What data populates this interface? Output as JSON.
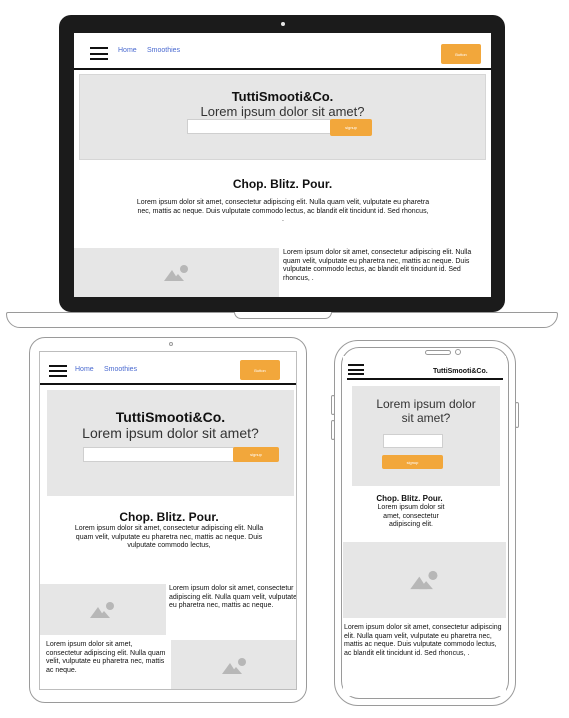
{
  "laptop": {
    "nav": {
      "home": "Home",
      "smoothies": "Smoothies",
      "button": "Button"
    },
    "hero": {
      "brand": "TuttiSmooti&Co.",
      "tagline": "Lorem ipsum dolor sit amet?",
      "input_placeholder": "",
      "signup": "signup"
    },
    "section": {
      "heading": "Chop. Blitz. Pour.",
      "paragraph": "Lorem ipsum dolor sit amet, consectetur adipiscing elit. Nulla quam velit, vulputate eu pharetra nec, mattis ac neque. Duis vulputate commodo lectus, ac blandit elit tincidunt id. Sed rhoncus, .",
      "side_text": "Lorem ipsum dolor sit amet, consectetur adipiscing elit. Nulla quam velit, vulputate eu pharetra nec, mattis ac neque. Duis vulputate commodo lectus, ac blandit elit tincidunt id. Sed rhoncus, ."
    }
  },
  "tablet": {
    "nav": {
      "home": "Home",
      "smoothies": "Smoothies",
      "button": "Button"
    },
    "hero": {
      "brand": "TuttiSmooti&Co.",
      "tagline": "Lorem ipsum dolor sit amet?",
      "input_placeholder": "",
      "signup": "signup"
    },
    "section": {
      "heading": "Chop. Blitz. Pour.",
      "paragraph": "Lorem ipsum dolor sit amet, consectetur adipiscing elit. Nulla quam velit, vulputate eu pharetra nec, mattis ac neque. Duis vulputate commodo lectus,",
      "side_text_1": "Lorem ipsum dolor sit amet, consectetur adipiscing elit. Nulla quam velit, vulputate eu pharetra nec, mattis ac neque.",
      "side_text_2": "Lorem ipsum dolor sit amet, consectetur adipiscing elit. Nulla quam velit, vulputate eu pharetra nec, mattis ac neque."
    }
  },
  "phone": {
    "nav": {
      "brand": "TuttiSmooti&Co."
    },
    "hero": {
      "tagline": "Lorem ipsum dolor sit amet?",
      "input_placeholder": "",
      "signup": "signup"
    },
    "section": {
      "heading": "Chop. Blitz. Pour.",
      "paragraph": "Lorem ipsum dolor sit amet, consectetur adipiscing elit.",
      "bottom_text": "Lorem ipsum dolor sit amet, consectetur adipiscing elit. Nulla quam velit, vulputate eu pharetra nec, mattis ac neque. Duis vulputate commodo lectus, ac blandit elit tincidunt id. Sed rhoncus, ."
    }
  },
  "colors": {
    "accent": "#f2a73b",
    "link": "#4a6ad0",
    "placeholder_bg": "#e6e6e6",
    "frame": "#1b1b1b"
  },
  "icons": {
    "menu": "hamburger-menu-icon",
    "image": "image-placeholder-icon"
  }
}
